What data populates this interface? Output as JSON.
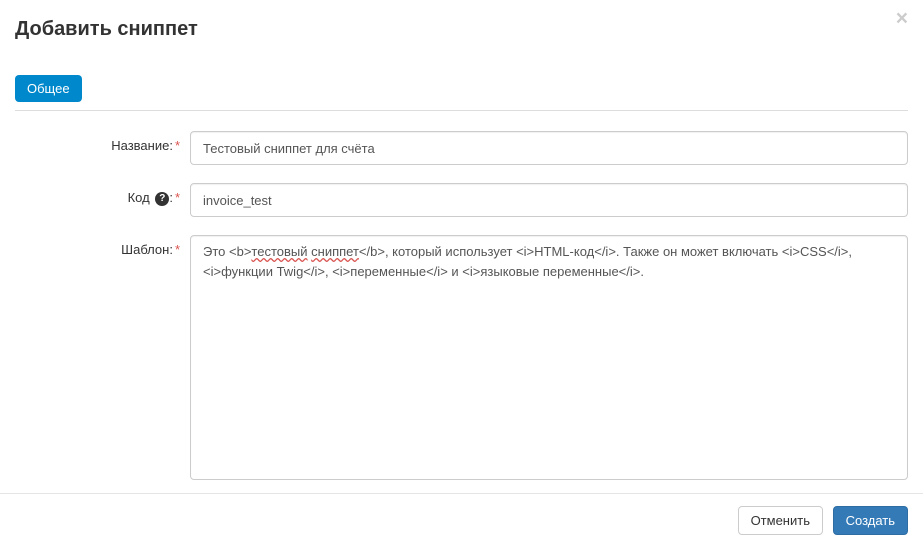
{
  "header": {
    "title": "Добавить сниппет"
  },
  "tabs": {
    "general": "Общее"
  },
  "form": {
    "name_label": "Название:",
    "name_value": "Тестовый сниппет для счёта",
    "code_label": "Код",
    "code_value": "invoice_test",
    "template_label": "Шаблон:",
    "template_prefix": "Это <b>",
    "template_word1": "тестовый",
    "template_mid1": " ",
    "template_word2": "сниппет",
    "template_suffix": "</b>, который использует <i>HTML-код</i>. Также он может включать <i>CSS</i>, <i>функции Twig</i>, <i>переменные</i> и <i>языковые переменные</i>."
  },
  "footer": {
    "cancel": "Отменить",
    "create": "Создать"
  }
}
